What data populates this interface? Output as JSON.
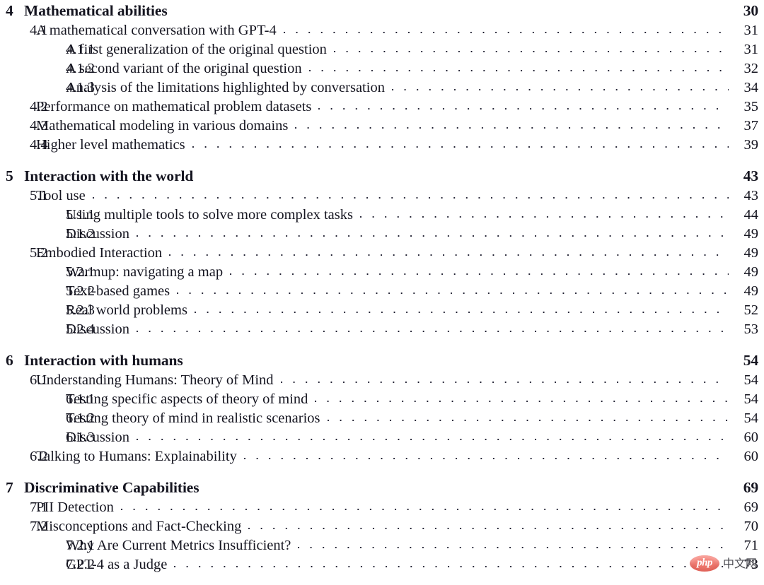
{
  "document": {
    "kind": "table-of-contents",
    "background_color": "#ffffff",
    "text_color": "#151520"
  },
  "entries": [
    {
      "level": "chapter",
      "number": "4",
      "title": "Mathematical abilities",
      "page": "30"
    },
    {
      "level": "section",
      "number": "4.1",
      "title": "A mathematical conversation with GPT-4",
      "page": "31"
    },
    {
      "level": "subsection",
      "number": "4.1.1",
      "title": "A first generalization of the original question",
      "page": "31"
    },
    {
      "level": "subsection",
      "number": "4.1.2",
      "title": "A second variant of the original question",
      "page": "32"
    },
    {
      "level": "subsection",
      "number": "4.1.3",
      "title": "Analysis of the limitations highlighted by conversation",
      "page": "34"
    },
    {
      "level": "section",
      "number": "4.2",
      "title": "Performance on mathematical problem datasets",
      "page": "35"
    },
    {
      "level": "section",
      "number": "4.3",
      "title": "Mathematical modeling in various domains",
      "page": "37"
    },
    {
      "level": "section",
      "number": "4.4",
      "title": "Higher level mathematics",
      "page": "39"
    },
    {
      "level": "chapter",
      "number": "5",
      "title": "Interaction with the world",
      "page": "43"
    },
    {
      "level": "section",
      "number": "5.1",
      "title": "Tool use",
      "page": "43"
    },
    {
      "level": "subsection",
      "number": "5.1.1",
      "title": "Using multiple tools to solve more complex tasks",
      "page": "44"
    },
    {
      "level": "subsection",
      "number": "5.1.2",
      "title": "Discussion",
      "page": "49"
    },
    {
      "level": "section",
      "number": "5.2",
      "title": "Embodied Interaction",
      "page": "49"
    },
    {
      "level": "subsection",
      "number": "5.2.1",
      "title": "Warmup: navigating a map",
      "page": "49"
    },
    {
      "level": "subsection",
      "number": "5.2.2",
      "title": "Text-based games",
      "page": "49"
    },
    {
      "level": "subsection",
      "number": "5.2.3",
      "title": "Real world problems",
      "page": "52"
    },
    {
      "level": "subsection",
      "number": "5.2.4",
      "title": "Discussion",
      "page": "53"
    },
    {
      "level": "chapter",
      "number": "6",
      "title": "Interaction with humans",
      "page": "54"
    },
    {
      "level": "section",
      "number": "6.1",
      "title": "Understanding Humans: Theory of Mind",
      "page": "54"
    },
    {
      "level": "subsection",
      "number": "6.1.1",
      "title": "Testing specific aspects of theory of mind",
      "page": "54"
    },
    {
      "level": "subsection",
      "number": "6.1.2",
      "title": "Testing theory of mind in realistic scenarios",
      "page": "54"
    },
    {
      "level": "subsection",
      "number": "6.1.3",
      "title": "Discussion",
      "page": "60"
    },
    {
      "level": "section",
      "number": "6.2",
      "title": "Talking to Humans: Explainability",
      "page": "60"
    },
    {
      "level": "chapter",
      "number": "7",
      "title": "Discriminative Capabilities",
      "page": "69"
    },
    {
      "level": "section",
      "number": "7.1",
      "title": "PII Detection",
      "page": "69"
    },
    {
      "level": "section",
      "number": "7.2",
      "title": "Misconceptions and Fact-Checking",
      "page": "70"
    },
    {
      "level": "subsection",
      "number": "7.2.1",
      "title": "Why Are Current Metrics Insufficient?",
      "page": "71"
    },
    {
      "level": "subsection",
      "number": "7.2.2",
      "title": "GPT-4 as a Judge",
      "page": "73"
    }
  ],
  "watermark": {
    "logo_text": "php",
    "site_text": "中文网",
    "logo_color": "#f07c72",
    "site_text_color": "#4a4a50"
  }
}
